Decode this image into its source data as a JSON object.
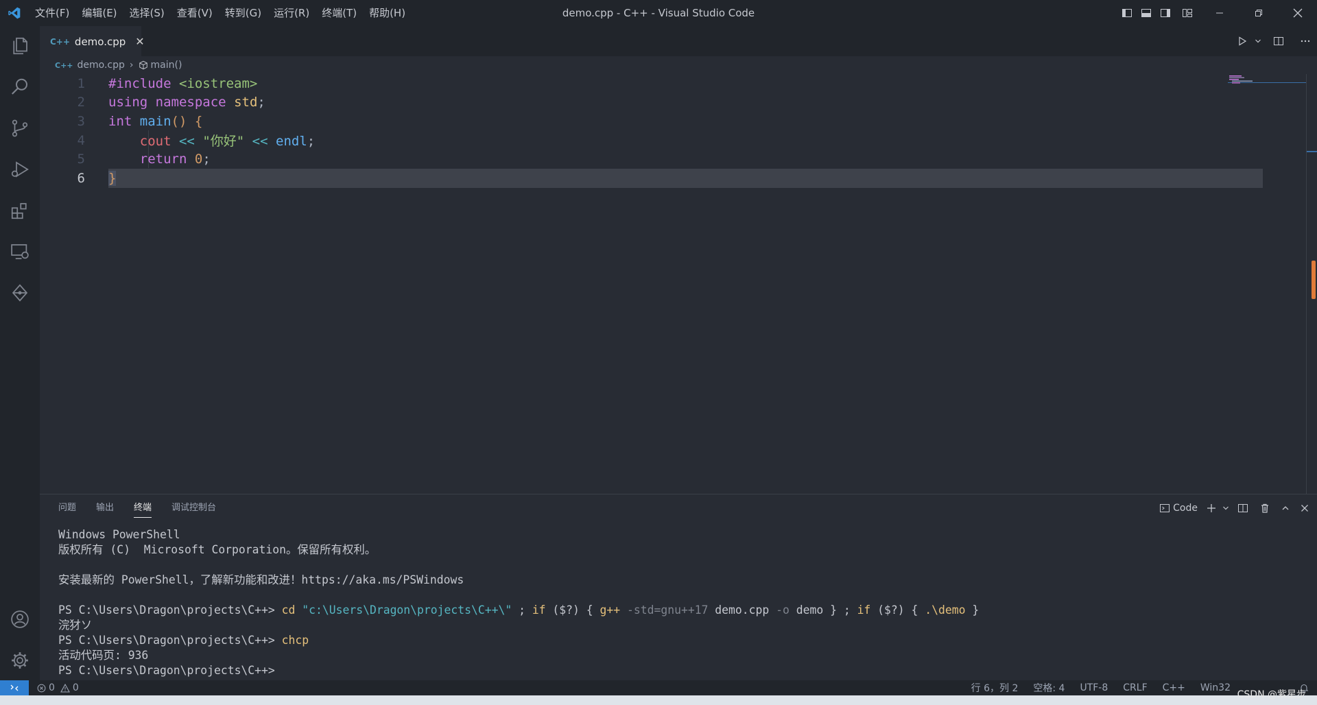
{
  "window": {
    "title": "demo.cpp - C++ - Visual Studio Code",
    "menu": [
      "文件(F)",
      "编辑(E)",
      "选择(S)",
      "查看(V)",
      "转到(G)",
      "运行(R)",
      "终端(T)",
      "帮助(H)"
    ]
  },
  "tab": {
    "icon_text": "C++",
    "label": "demo.cpp"
  },
  "breadcrumb": {
    "file": "demo.cpp",
    "symbol": "main()"
  },
  "code": {
    "line_numbers": [
      "1",
      "2",
      "3",
      "4",
      "5",
      "6"
    ],
    "lines": {
      "l1": {
        "a": "#include",
        "b": " ",
        "c": "<iostream>"
      },
      "l2": {
        "a": "using",
        "b": " ",
        "c": "namespace",
        "d": " ",
        "e": "std",
        "f": ";"
      },
      "l3": {
        "a": "int",
        "b": " ",
        "c": "main",
        "d": "()",
        "e": " ",
        "f": "{"
      },
      "l4": {
        "indent": "    ",
        "a": "cout",
        "b": " ",
        "c": "<<",
        "d": " ",
        "e": "\"你好\"",
        "f": " ",
        "g": "<<",
        "h": " ",
        "i": "endl",
        "j": ";"
      },
      "l5": {
        "indent": "    ",
        "a": "return",
        "b": " ",
        "c": "0",
        "d": ";"
      },
      "l6": {
        "a": "}"
      }
    }
  },
  "panel": {
    "tabs": [
      "问题",
      "输出",
      "终端",
      "调试控制台"
    ],
    "terminal_name": "Code",
    "terminal": {
      "t1": "Windows PowerShell",
      "t2": "版权所有 (C)  Microsoft Corporation。保留所有权利。",
      "t3": "",
      "t4": "安装最新的 PowerShell，了解新功能和改进！https://aka.ms/PSWindows",
      "t5": "",
      "t6": {
        "prompt": "PS C:\\Users\\Dragon\\projects\\C++> ",
        "cd": "cd",
        "path": "\"c:\\Users\\Dragon\\projects\\C++\\\"",
        "semi1": " ; ",
        "if1": "if",
        "cond1": " ($?) ",
        "b1": "{ ",
        "gpp": "g++",
        "args1": " -std=gnu++17",
        "args2": " demo.cpp",
        "args3": " -o",
        "args4": " demo",
        "b2": " }",
        "semi2": " ; ",
        "if2": "if",
        "cond2": " ($?) ",
        "b3": "{ ",
        "exe": ".\\demo",
        "b4": " }"
      },
      "t7": "浣犲ソ",
      "t8": {
        "prompt": "PS C:\\Users\\Dragon\\projects\\C++> ",
        "cmd": "chcp"
      },
      "t9": "活动代码页: 936",
      "t10": "PS C:\\Users\\Dragon\\projects\\C++>"
    }
  },
  "status": {
    "errors": "0",
    "warnings": "0",
    "position": "行 6，列 2",
    "spaces": "空格: 4",
    "encoding": "UTF-8",
    "eol": "CRLF",
    "language": "C++",
    "platform": "Win32",
    "watermark": "CSDN @紫星步"
  },
  "colors": {
    "accent": "#2f7fd1",
    "editor_bg": "#282c34",
    "chrome_bg": "#21252b"
  }
}
